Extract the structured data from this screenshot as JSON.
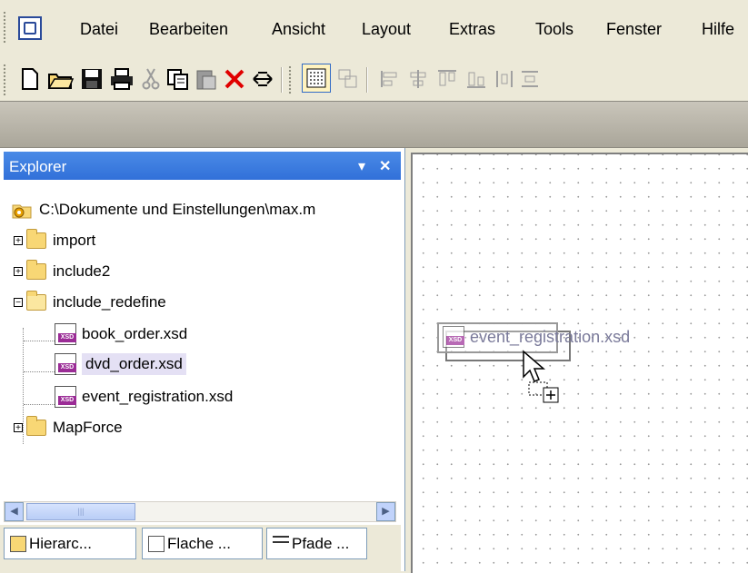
{
  "menu": {
    "items": [
      {
        "label": "Datei"
      },
      {
        "label": "Bearbeiten"
      },
      {
        "label": "Ansicht"
      },
      {
        "label": "Layout"
      },
      {
        "label": "Extras"
      },
      {
        "label": "Tools"
      },
      {
        "label": "Fenster"
      },
      {
        "label": "Hilfe"
      }
    ]
  },
  "explorer": {
    "title": "Explorer",
    "root_path": "C:\\Dokumente und Einstellungen\\max.m",
    "items": [
      {
        "label": "import",
        "type": "folder",
        "expanded": false
      },
      {
        "label": "include2",
        "type": "folder",
        "expanded": false
      },
      {
        "label": "include_redefine",
        "type": "folder",
        "expanded": true
      },
      {
        "label": "book_order.xsd",
        "type": "xsd"
      },
      {
        "label": "dvd_order.xsd",
        "type": "xsd",
        "selected": true
      },
      {
        "label": "event_registration.xsd",
        "type": "xsd"
      },
      {
        "label": "MapForce",
        "type": "folder",
        "expanded": false
      }
    ],
    "tabs": [
      {
        "label": "Hierarc..."
      },
      {
        "label": "Flache ..."
      },
      {
        "label": "Pfade ..."
      }
    ]
  },
  "canvas": {
    "drag_item_label": "event_registration.xsd"
  },
  "colors": {
    "title_bar": "#3170d9",
    "selection": "#e4e0f4",
    "xsd_badge": "#9b2c96"
  }
}
